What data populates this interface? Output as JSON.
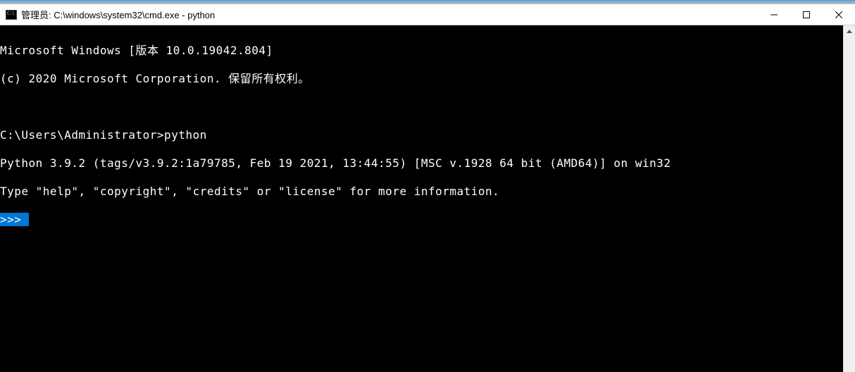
{
  "window": {
    "title": "管理员: C:\\windows\\system32\\cmd.exe - python"
  },
  "terminal": {
    "line1": "Microsoft Windows [版本 10.0.19042.804]",
    "line2": "(c) 2020 Microsoft Corporation. 保留所有权利。",
    "line3": "",
    "line4": "C:\\Users\\Administrator>python",
    "line5": "Python 3.9.2 (tags/v3.9.2:1a79785, Feb 19 2021, 13:44:55) [MSC v.1928 64 bit (AMD64)] on win32",
    "line6": "Type \"help\", \"copyright\", \"credits\" or \"license\" for more information.",
    "line7_prompt": ">>> "
  }
}
